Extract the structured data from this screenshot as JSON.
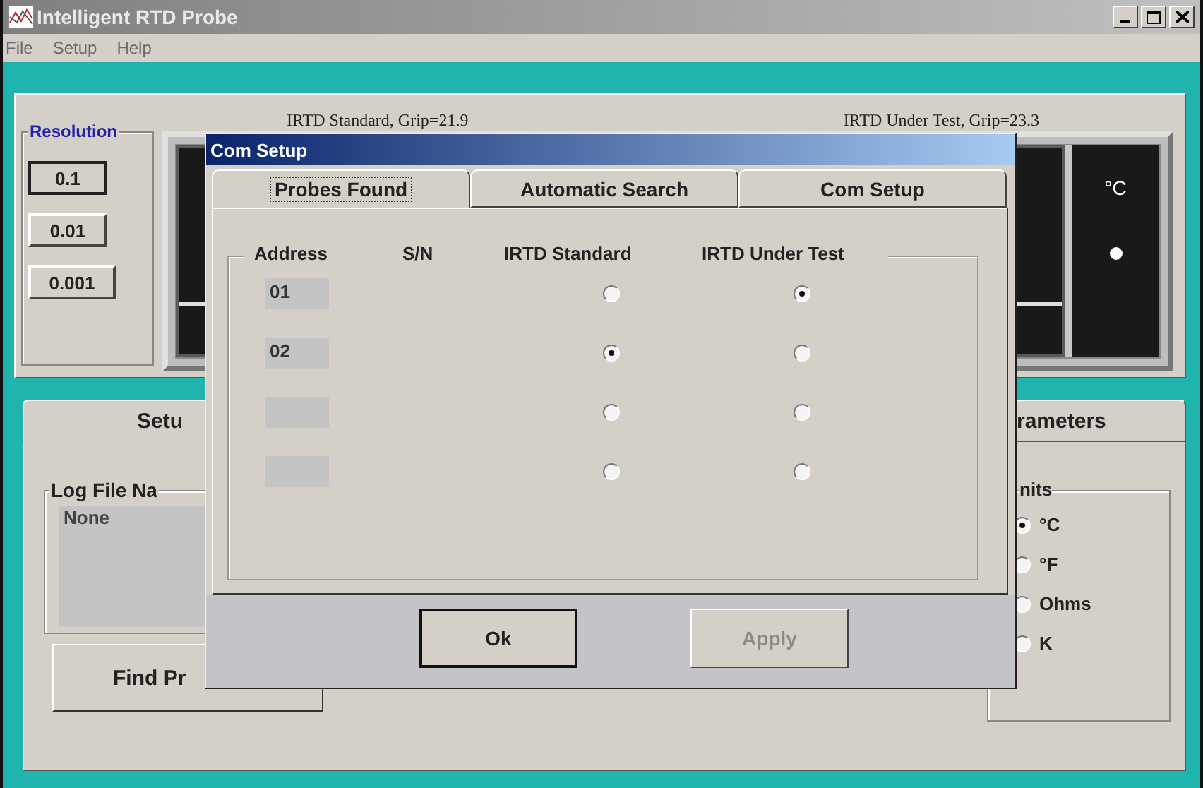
{
  "window": {
    "title": "Intelligent RTD Probe",
    "active": false
  },
  "menu": [
    "File",
    "Setup",
    "Help"
  ],
  "resolution": {
    "title": "Resolution",
    "buttons": [
      {
        "label": "0.1",
        "selected": true
      },
      {
        "label": "0.01",
        "selected": false
      },
      {
        "label": "0.001",
        "selected": false
      }
    ]
  },
  "displays": [
    {
      "caption": "IRTD Standard, Grip=21.9"
    },
    {
      "caption": "IRTD Under Test, Grip=23.3",
      "unit": "°C"
    }
  ],
  "main_tabs": [
    {
      "label": "Setu",
      "selected": true
    },
    {
      "label": "rameters",
      "selected": false
    }
  ],
  "log_file": {
    "label": "Log File Na",
    "value": "None"
  },
  "find_button": "Find Pr",
  "units": {
    "title": "nits",
    "options": [
      {
        "label": "°C",
        "selected": true
      },
      {
        "label": "°F",
        "selected": false
      },
      {
        "label": "Ohms",
        "selected": false
      },
      {
        "label": "K",
        "selected": false
      }
    ]
  },
  "dialog": {
    "title": "Com Setup",
    "tabs": [
      {
        "label": "Probes Found",
        "selected": true
      },
      {
        "label": "Automatic Search",
        "selected": false
      },
      {
        "label": "Com Setup",
        "selected": false
      }
    ],
    "columns": [
      "Address",
      "S/N",
      "IRTD Standard",
      "IRTD Under Test"
    ],
    "rows": [
      {
        "address": "01",
        "standard": false,
        "under_test": true
      },
      {
        "address": "02",
        "standard": true,
        "under_test": false
      },
      {
        "standard": false,
        "under_test": false
      },
      {
        "standard": false,
        "under_test": false
      }
    ],
    "buttons": [
      {
        "label": "Ok",
        "disabled": false
      },
      {
        "label": "Apply",
        "disabled": true
      }
    ]
  }
}
